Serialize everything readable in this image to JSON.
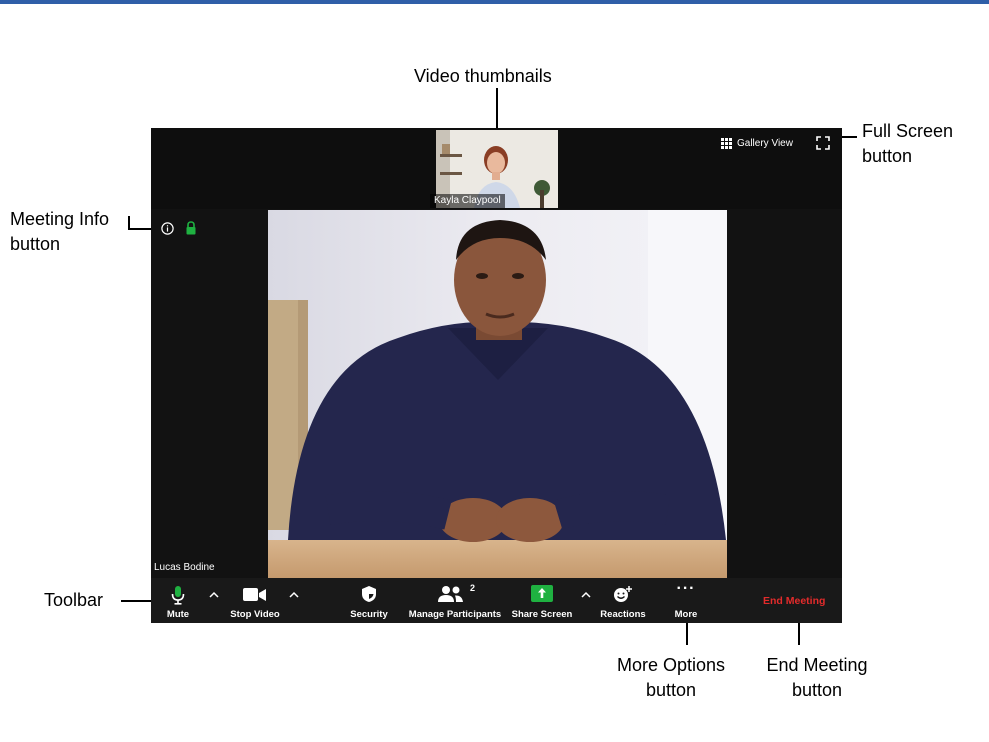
{
  "callouts": {
    "video_thumbnails": "Video thumbnails",
    "full_screen_line1": "Full Screen",
    "full_screen_line2": "button",
    "meeting_info_line1": "Meeting Info",
    "meeting_info_line2": "button",
    "toolbar": "Toolbar",
    "more_options_line1": "More Options",
    "more_options_line2": "button",
    "end_meeting_line1": "End Meeting",
    "end_meeting_line2": "button"
  },
  "meeting": {
    "thumbnail_name": "Kayla Claypool",
    "speaker_name": "Lucas Bodine",
    "gallery_view_label": "Gallery View"
  },
  "toolbar": {
    "mute_label": "Mute",
    "stop_video_label": "Stop Video",
    "security_label": "Security",
    "participants_label": "Manage Participants",
    "participants_count": "2",
    "share_screen_label": "Share Screen",
    "reactions_label": "Reactions",
    "more_label": "More",
    "more_icon_text": "···",
    "end_meeting_label": "End Meeting"
  },
  "colors": {
    "accent_green": "#1fb141",
    "end_red": "#e32b2b",
    "topbar_blue": "#2f5fa8"
  },
  "icons": [
    "info-icon",
    "lock-icon",
    "microphone-icon",
    "video-camera-icon",
    "shield-icon",
    "participants-icon",
    "share-screen-icon",
    "reaction-icon",
    "more-icon",
    "gallery-grid-icon",
    "fullscreen-icon",
    "caret-up-icon"
  ]
}
